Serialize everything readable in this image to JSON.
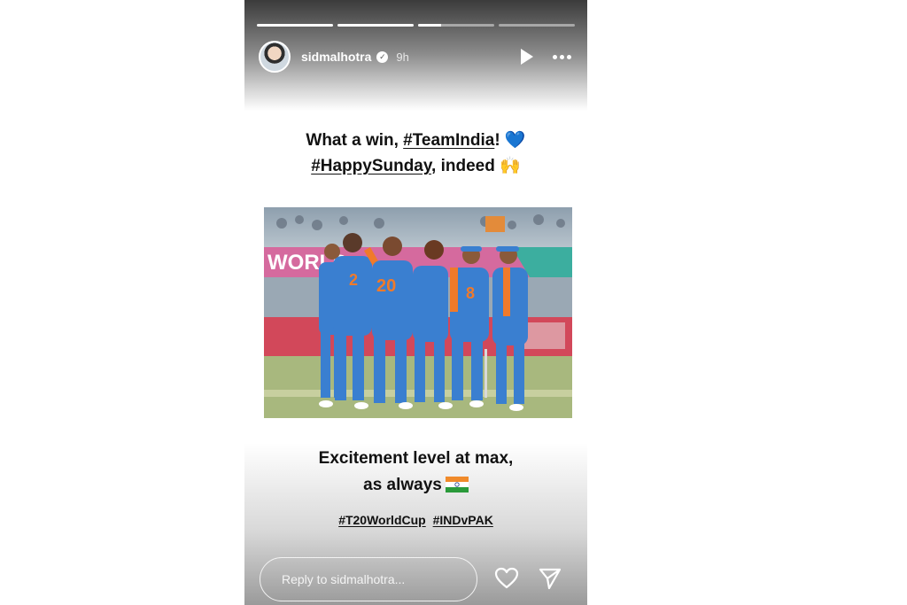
{
  "story": {
    "progress": [
      1,
      1,
      0.3,
      0
    ],
    "username": "sidmalhotra",
    "verified_icon": "verified-badge-icon",
    "time": "9h",
    "icons": [
      "play-icon",
      "more-icon"
    ]
  },
  "caption": {
    "line1_pre": "What a win, ",
    "line1_tag": "#TeamIndia",
    "line1_post": "! ",
    "line1_emoji": "💙",
    "line2_tag": "#HappySunday",
    "line2_post": ", indeed ",
    "line2_emoji": "🙌"
  },
  "photo": {
    "banner_text": "WORLD",
    "jersey_numbers": [
      "2",
      "20",
      "8"
    ]
  },
  "caption2": {
    "line1": "Excitement level at max,",
    "line2": "as always"
  },
  "hashtags": [
    "#T20WorldCup",
    "#INDvPAK"
  ],
  "reply": {
    "placeholder": "Reply to sidmalhotra..."
  },
  "colors": {
    "jersey": "#3a7fd0",
    "orange": "#f07a2a",
    "heart": "#2a7bd6"
  }
}
